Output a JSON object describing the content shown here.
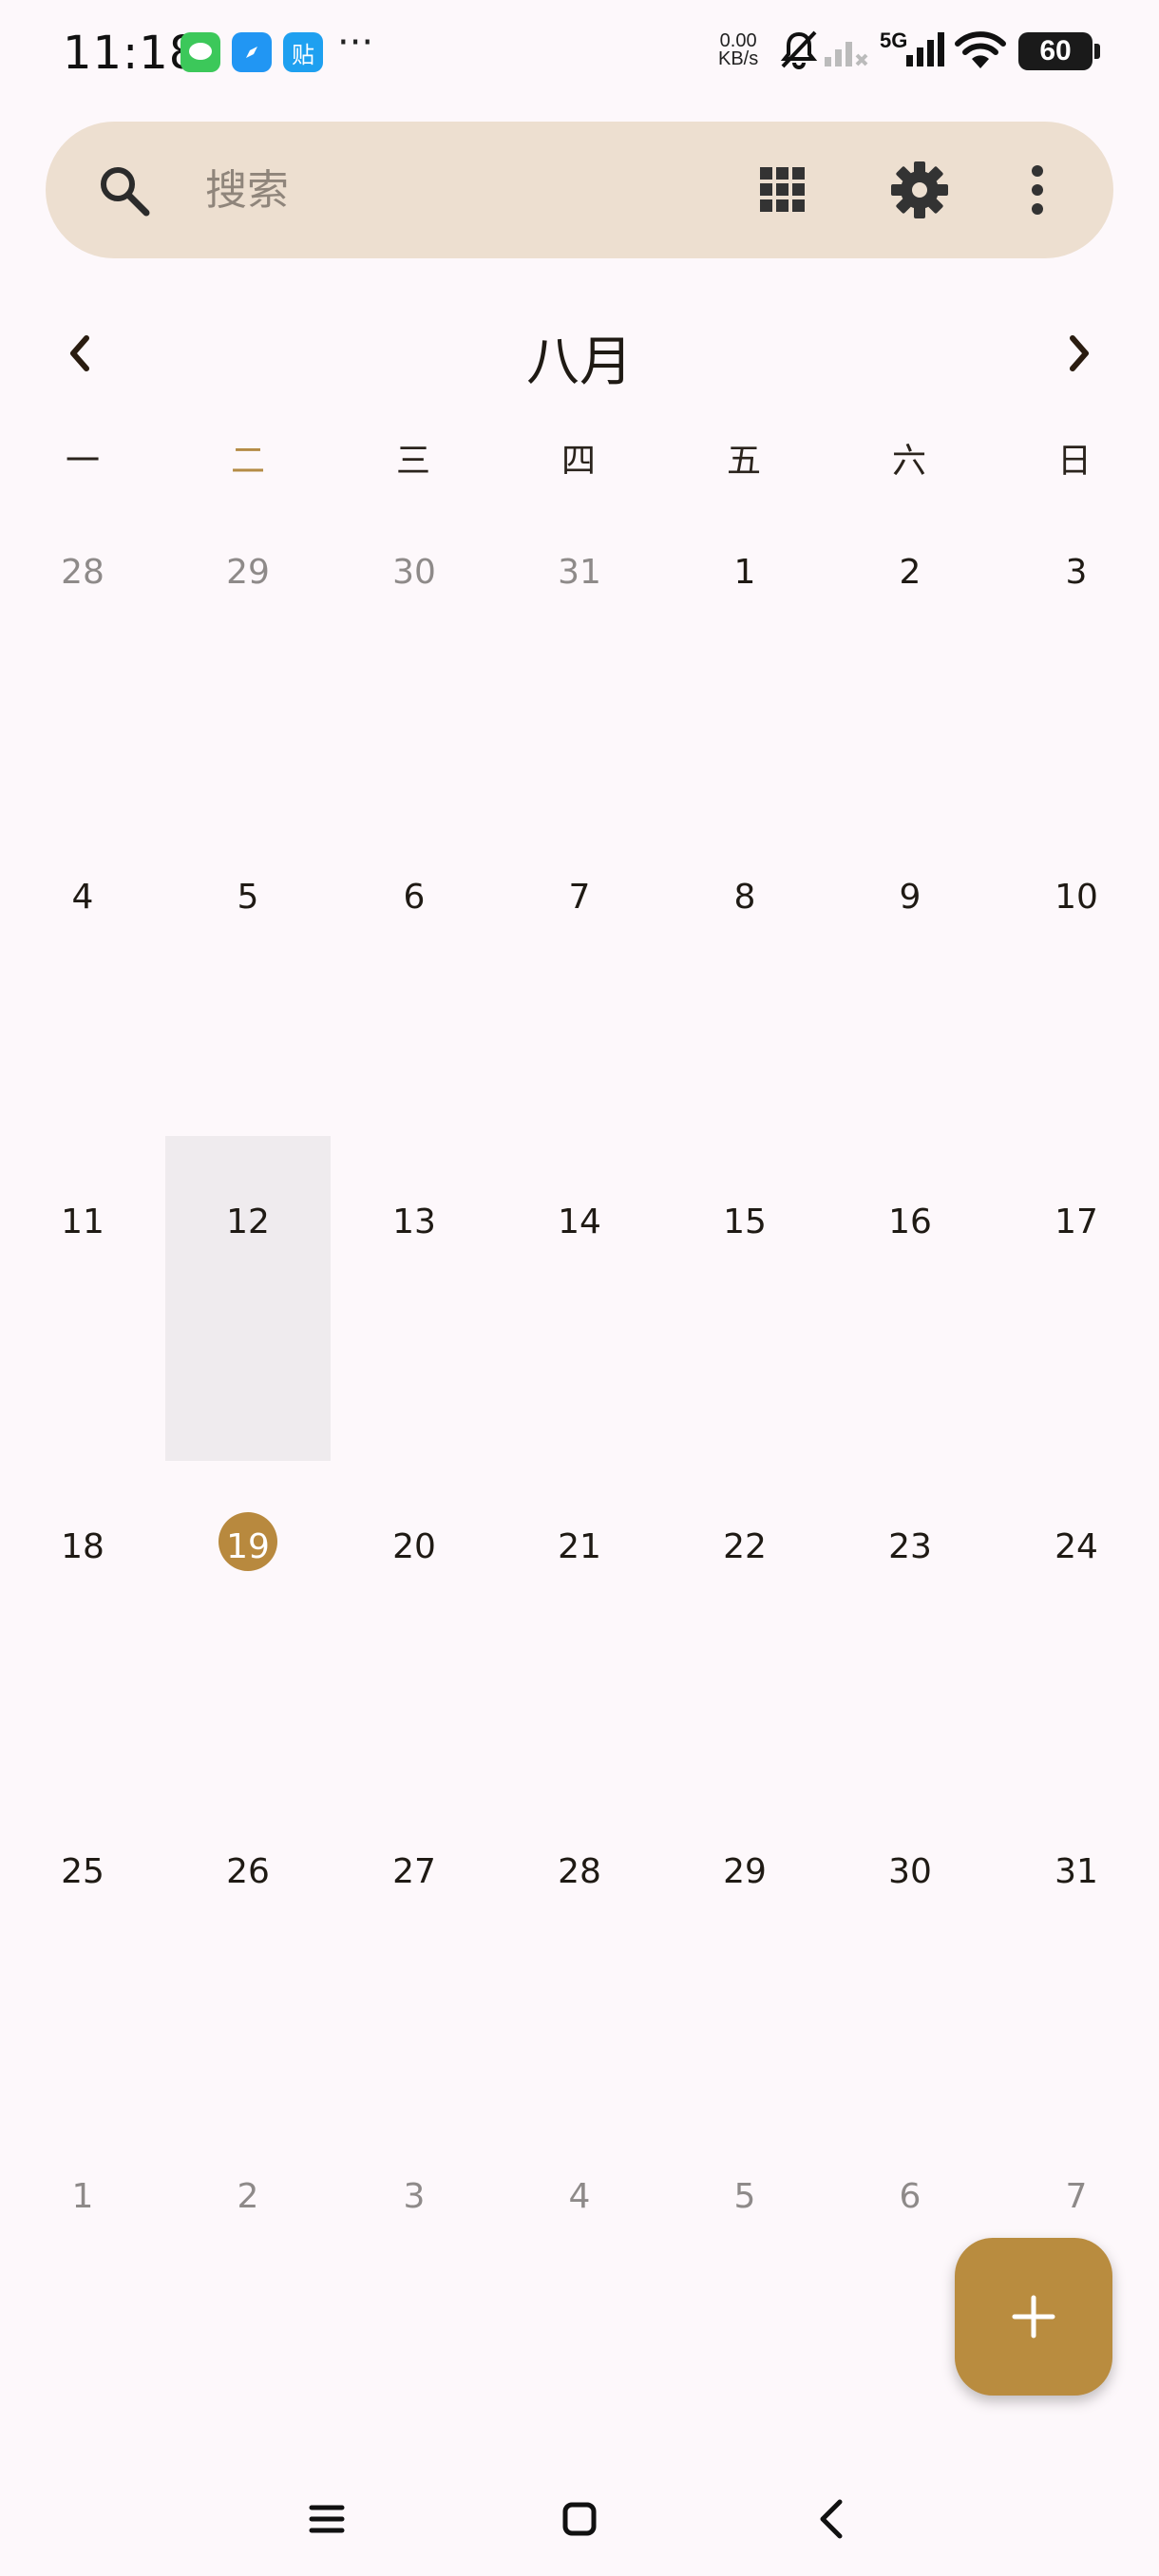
{
  "status_bar": {
    "time": "11:18",
    "app_icons": [
      {
        "name": "messages-app-icon",
        "color": "#3CC85A"
      },
      {
        "name": "browser-app-icon",
        "color": "#2196F3"
      },
      {
        "name": "tieba-app-icon",
        "color": "#1EA0F0",
        "label": "贴"
      }
    ],
    "more": "···",
    "net_speed_value": "0.00",
    "net_speed_unit": "KB/s",
    "network_type": "5G",
    "battery": "60"
  },
  "search": {
    "placeholder": "搜索"
  },
  "calendar": {
    "month_title": "八月",
    "weekdays": [
      "一",
      "二",
      "三",
      "四",
      "五",
      "六",
      "日"
    ],
    "today_weekday_index": 1,
    "weeks": [
      [
        {
          "d": "28",
          "m": true
        },
        {
          "d": "29",
          "m": true
        },
        {
          "d": "30",
          "m": true
        },
        {
          "d": "31",
          "m": true
        },
        {
          "d": "1"
        },
        {
          "d": "2"
        },
        {
          "d": "3"
        }
      ],
      [
        {
          "d": "4"
        },
        {
          "d": "5"
        },
        {
          "d": "6"
        },
        {
          "d": "7"
        },
        {
          "d": "8"
        },
        {
          "d": "9"
        },
        {
          "d": "10"
        }
      ],
      [
        {
          "d": "11"
        },
        {
          "d": "12",
          "selected": true
        },
        {
          "d": "13"
        },
        {
          "d": "14"
        },
        {
          "d": "15"
        },
        {
          "d": "16"
        },
        {
          "d": "17"
        }
      ],
      [
        {
          "d": "18"
        },
        {
          "d": "19",
          "today": true
        },
        {
          "d": "20"
        },
        {
          "d": "21"
        },
        {
          "d": "22"
        },
        {
          "d": "23"
        },
        {
          "d": "24"
        }
      ],
      [
        {
          "d": "25"
        },
        {
          "d": "26"
        },
        {
          "d": "27"
        },
        {
          "d": "28"
        },
        {
          "d": "29"
        },
        {
          "d": "30"
        },
        {
          "d": "31"
        }
      ],
      [
        {
          "d": "1",
          "m": true
        },
        {
          "d": "2",
          "m": true
        },
        {
          "d": "3",
          "m": true
        },
        {
          "d": "4",
          "m": true
        },
        {
          "d": "5",
          "m": true
        },
        {
          "d": "6",
          "m": true
        },
        {
          "d": "7",
          "m": true
        }
      ]
    ]
  },
  "colors": {
    "accent": "#B8893E",
    "searchbar_bg": "#EDDFD0",
    "selected_cell_bg": "#EFEBEE",
    "background": "#FDF8FB"
  }
}
